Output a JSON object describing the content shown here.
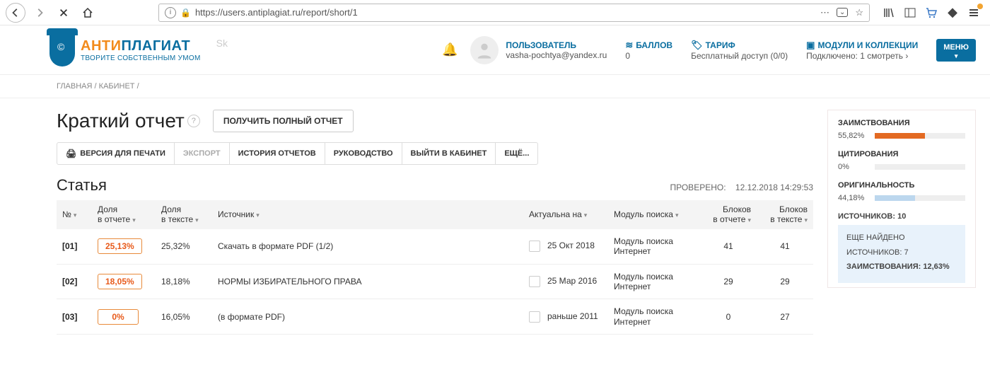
{
  "browser": {
    "url": "https://users.antiplagiat.ru/report/short/1"
  },
  "logo": {
    "anti": "АНТИ",
    "plag": "ПЛАГИАТ",
    "sub": "ТВОРИТЕ СОБСТВЕННЫМ УМОМ",
    "sk": "Sk"
  },
  "header": {
    "user_label": "ПОЛЬЗОВАТЕЛЬ",
    "user_email": "vasha-pochtya@yandex.ru",
    "points_label": "БАЛЛОВ",
    "points_value": "0",
    "tariff_label": "ТАРИФ",
    "tariff_value": "Бесплатный доступ (0/0)",
    "modules_label": "МОДУЛИ И КОЛЛЕКЦИИ",
    "modules_value": "Подключено: 1 смотреть ›",
    "menu": "МЕНЮ"
  },
  "breadcrumb": {
    "home": "ГЛАВНАЯ",
    "cabinet": "КАБИНЕТ"
  },
  "page": {
    "title": "Краткий отчет",
    "full_report_btn": "ПОЛУЧИТЬ ПОЛНЫЙ ОТЧЕТ"
  },
  "tabs": {
    "print": "ВЕРСИЯ ДЛЯ ПЕЧАТИ",
    "export": "ЭКСПОРТ",
    "history": "ИСТОРИЯ ОТЧЕТОВ",
    "guide": "РУКОВОДСТВО",
    "exit": "ВЫЙТИ В КАБИНЕТ",
    "more": "ЕЩЁ..."
  },
  "section": {
    "title": "Статья",
    "checked_label": "ПРОВЕРЕНО:",
    "checked_time": "12.12.2018 14:29:53"
  },
  "table": {
    "headers": {
      "num": "№",
      "share_report_1": "Доля",
      "share_report_2": "в отчете",
      "share_text_1": "Доля",
      "share_text_2": "в тексте",
      "source": "Источник",
      "actual": "Актуальна на",
      "module": "Модуль поиска",
      "blocks_report_1": "Блоков",
      "blocks_report_2": "в отчете",
      "blocks_text_1": "Блоков",
      "blocks_text_2": "в тексте"
    },
    "rows": [
      {
        "num": "[01]",
        "share_report": "25,13%",
        "share_text": "25,32%",
        "source": "Скачать в формате PDF (1/2)",
        "actual": "25 Окт 2018",
        "module": "Модуль поиска Интернет",
        "blocks_report": "41",
        "blocks_text": "41"
      },
      {
        "num": "[02]",
        "share_report": "18,05%",
        "share_text": "18,18%",
        "source": "НОРМЫ ИЗБИРАТЕЛЬНОГО ПРАВА",
        "actual": "25 Мар 2016",
        "module": "Модуль поиска Интернет",
        "blocks_report": "29",
        "blocks_text": "29"
      },
      {
        "num": "[03]",
        "share_report": "0%",
        "share_text": "16,05%",
        "source": "(в формате PDF)",
        "actual": "раньше 2011",
        "module": "Модуль поиска Интернет",
        "blocks_report": "0",
        "blocks_text": "27"
      }
    ]
  },
  "side": {
    "borrow_label": "ЗАИМСТВОВАНИЯ",
    "borrow_pct": "55,82%",
    "borrow_fill": 55.82,
    "citation_label": "ЦИТИРОВАНИЯ",
    "citation_pct": "0%",
    "citation_fill": 0,
    "orig_label": "ОРИГИНАЛЬНОСТЬ",
    "orig_pct": "44,18%",
    "orig_fill": 44.18,
    "sources_label": "ИСТОЧНИКОВ:  10",
    "more_line1": "ЕЩЕ НАЙДЕНО",
    "more_line2": "ИСТОЧНИКОВ: 7",
    "more_line3": "ЗАИМСТВОВАНИЯ: 12,63%"
  }
}
